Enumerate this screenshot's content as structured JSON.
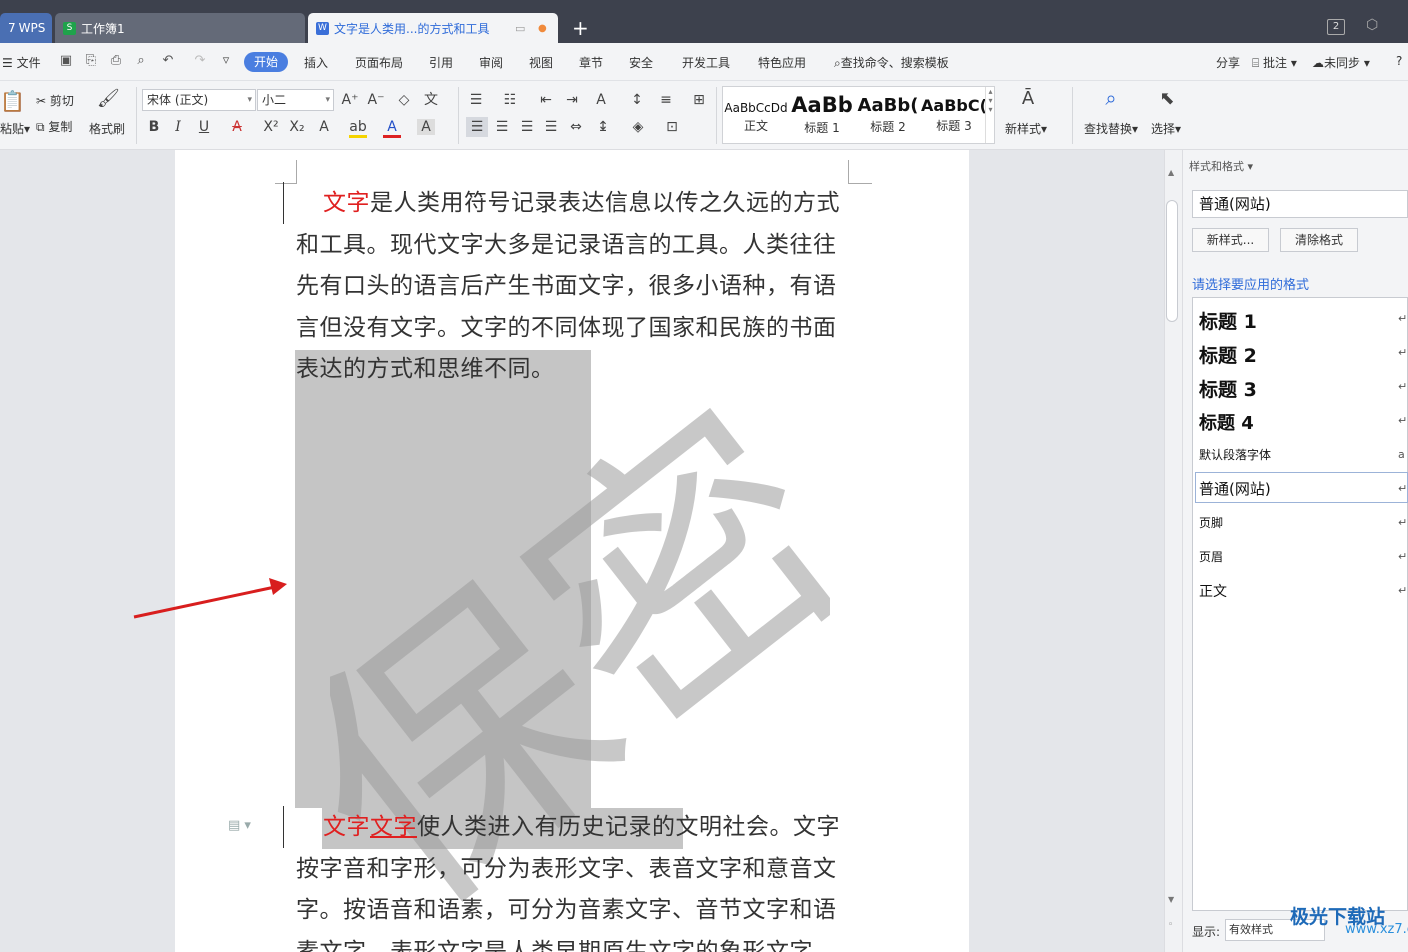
{
  "tabs": {
    "wps": "WPS",
    "sheet": "工作簿1",
    "doc": "文字是人类用...的方式和工具",
    "window_count": "2"
  },
  "menu": {
    "file": "文件",
    "start": "开始",
    "insert": "插入",
    "layout": "页面布局",
    "reference": "引用",
    "review": "审阅",
    "view": "视图",
    "chapter": "章节",
    "security": "安全",
    "devtools": "开发工具",
    "special": "特色应用",
    "search": "查找命令、搜索模板",
    "share": "分享",
    "comment": "批注",
    "sync": "未同步"
  },
  "ribbon": {
    "paste": "粘贴",
    "cut": "剪切",
    "copy": "复制",
    "format_painter": "格式刷",
    "font": "宋体 (正文)",
    "size": "小二",
    "new_style": "新样式",
    "find_replace": "查找替换",
    "select": "选择"
  },
  "gallery": [
    {
      "preview": "AaBbCcDd",
      "name": "正文"
    },
    {
      "preview": "AaBb",
      "name": "标题 1"
    },
    {
      "preview": "AaBb(",
      "name": "标题 2"
    },
    {
      "preview": "AaBbC(",
      "name": "标题 3"
    }
  ],
  "document": {
    "para1_red": "文字",
    "para1_text": "是人类用符号记录表达信息以传之久远的方式和工具。现代文字大多是记录语言的工具。人类往往先有口头的语言后产生书面文字，很多小语种，有语言但没有文字。文字的不同体现了国家和民族的书面表达的方式和思维不同。",
    "para2_red1": "文字",
    "para2_red2": "文字",
    "para2_text": "使人类进入有历史记录的文明社会。文字按字音和字形，可分为表形文字、表音文字和意音文字。按语音和语素，可分为音素文字、音节文字和语素文字。表形文字是人类早期原生文字的象形文字",
    "watermark": "保密"
  },
  "pane": {
    "title": "样式和格式",
    "current": "普通(网站)",
    "new_btn": "新样式...",
    "clear_btn": "清除格式",
    "prompt": "请选择要应用的格式",
    "styles": [
      {
        "name": "标题  1",
        "kind": "h"
      },
      {
        "name": "标题  2",
        "kind": "h"
      },
      {
        "name": "标题  3",
        "kind": "h"
      },
      {
        "name": "标题  4",
        "kind": "h"
      },
      {
        "name": "默认段落字体",
        "kind": "s"
      },
      {
        "name": "普通(网站)",
        "kind": "n"
      },
      {
        "name": "页脚",
        "kind": "s"
      },
      {
        "name": "页眉",
        "kind": "s"
      },
      {
        "name": "正文",
        "kind": "n"
      }
    ],
    "show_label": "显示:",
    "show_value": "有效样式"
  },
  "watermark_site": {
    "name": "极光下载站",
    "url": "www.xz7.com"
  },
  "colors": {
    "accent": "#4a7ee0",
    "red": "#e02020",
    "selection": "#c5c5c5"
  }
}
